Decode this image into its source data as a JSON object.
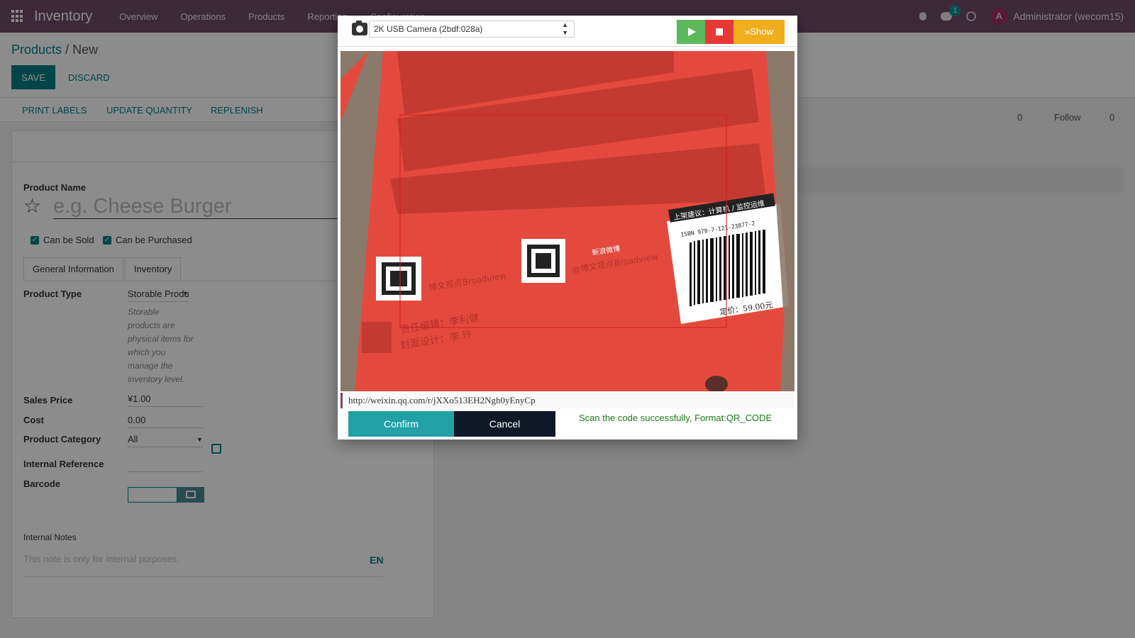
{
  "navbar": {
    "app_name": "Inventory",
    "menu": [
      "Overview",
      "Operations",
      "Products",
      "Reporting",
      "Configuration"
    ],
    "chat_count": "1",
    "avatar_letter": "A",
    "user": "Administrator (wecom15)"
  },
  "breadcrumb": {
    "parent": "Products",
    "separator": "/",
    "current": "New"
  },
  "actions": {
    "save": "SAVE",
    "discard": "DISCARD"
  },
  "statusbar": {
    "print_labels": "PRINT LABELS",
    "update_quantity": "UPDATE QUANTITY",
    "replenish": "REPLENISH"
  },
  "chatter": {
    "attachments": "0",
    "follow": "Follow",
    "followers": "0"
  },
  "form": {
    "product_name_label": "Product Name",
    "product_name_placeholder": "e.g. Cheese Burger",
    "can_be_sold": "Can be Sold",
    "can_be_purchased": "Can be Purchased",
    "tabs": [
      "General Information",
      "Inventory"
    ],
    "product_type_label": "Product Type",
    "product_type_value": "Storable Product",
    "product_type_help": "Storable products are physical items for which you manage the inventory level.",
    "sales_price_label": "Sales Price",
    "sales_price_value": "¥1.00",
    "cost_label": "Cost",
    "cost_value": "0.00",
    "category_label": "Product Category",
    "category_value": "All",
    "internal_ref_label": "Internal Reference",
    "barcode_label": "Barcode",
    "notes_label": "Internal Notes",
    "notes_placeholder": "This note is only for internal purposes.",
    "lang": "EN"
  },
  "scanner": {
    "camera_device": "2K USB Camera (2bdf:028a)",
    "show_label": "»Show",
    "result_url": "http://weixin.qq.com/r/jXXo513EH2Ngh0yEnyCp",
    "confirm": "Confirm",
    "cancel": "Cancel",
    "status": "Scan the code successfully, Format:QR_CODE",
    "book": {
      "isbn": "ISBN 978-7-121-23877-2",
      "price": "定价：59.00元",
      "shelf_tag": "上架建议：计算机 / 监控运维",
      "editor": "责任编辑：李利健",
      "cover_design": "封面设计：李  玲",
      "wechat_label": "博文视点Broadview",
      "weibo_label": "@博文视点Broadview",
      "weibo_name": "新浪微博"
    }
  },
  "colors": {
    "brand": "#714b67",
    "accent": "#017e84",
    "book_cover": "#e4473c"
  }
}
